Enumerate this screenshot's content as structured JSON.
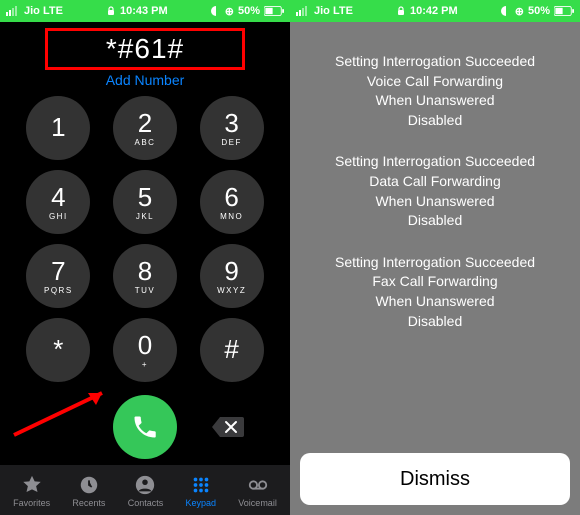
{
  "left": {
    "status": {
      "carrier": "Jio  LTE",
      "time": "10:43 PM",
      "battery_pct": "50%"
    },
    "dialed": "*#61#",
    "add_number": "Add Number",
    "keys": [
      {
        "digit": "1",
        "letters": ""
      },
      {
        "digit": "2",
        "letters": "ABC"
      },
      {
        "digit": "3",
        "letters": "DEF"
      },
      {
        "digit": "4",
        "letters": "GHI"
      },
      {
        "digit": "5",
        "letters": "JKL"
      },
      {
        "digit": "6",
        "letters": "MNO"
      },
      {
        "digit": "7",
        "letters": "PQRS"
      },
      {
        "digit": "8",
        "letters": "TUV"
      },
      {
        "digit": "9",
        "letters": "WXYZ"
      },
      {
        "digit": "*",
        "letters": ""
      },
      {
        "digit": "0",
        "letters": "+"
      },
      {
        "digit": "#",
        "letters": ""
      }
    ],
    "tabs": {
      "favorites": "Favorites",
      "recents": "Recents",
      "contacts": "Contacts",
      "keypad": "Keypad",
      "voicemail": "Voicemail"
    }
  },
  "right": {
    "status": {
      "carrier": "Jio  LTE",
      "time": "10:42 PM",
      "battery_pct": "50%"
    },
    "blocks": [
      [
        "Setting Interrogation Succeeded",
        "Voice Call Forwarding",
        "When Unanswered",
        "Disabled"
      ],
      [
        "Setting Interrogation Succeeded",
        "Data Call Forwarding",
        "When Unanswered",
        "Disabled"
      ],
      [
        "Setting Interrogation Succeeded",
        "Fax Call Forwarding",
        "When Unanswered",
        "Disabled"
      ]
    ],
    "dismiss": "Dismiss"
  }
}
